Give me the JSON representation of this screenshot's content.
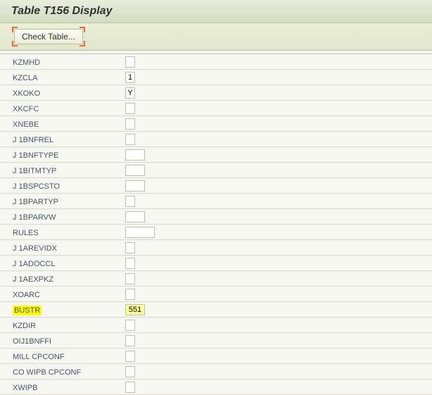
{
  "title": "Table T156 Display",
  "toolbar": {
    "check_label": "Check Table..."
  },
  "fields": [
    {
      "label": "KZMHD",
      "value": "",
      "w": 1,
      "hl": false
    },
    {
      "label": "KZCLA",
      "value": "1",
      "w": 1,
      "hl": false
    },
    {
      "label": "XKOKO",
      "value": "Y",
      "w": 1,
      "hl": false
    },
    {
      "label": "XKCFC",
      "value": "",
      "w": 1,
      "hl": false
    },
    {
      "label": "XNEBE",
      "value": "",
      "w": 1,
      "hl": false
    },
    {
      "label": "J 1BNFREL",
      "value": "",
      "w": 1,
      "hl": false
    },
    {
      "label": "J 1BNFTYPE",
      "value": "",
      "w": 2,
      "hl": false
    },
    {
      "label": "J 1BITMTYP",
      "value": "",
      "w": 2,
      "hl": false
    },
    {
      "label": "J 1BSPCSTO",
      "value": "",
      "w": 2,
      "hl": false
    },
    {
      "label": "J 1BPARTYP",
      "value": "",
      "w": 1,
      "hl": false
    },
    {
      "label": "J 1BPARVW",
      "value": "",
      "w": 2,
      "hl": false
    },
    {
      "label": "RULES",
      "value": "",
      "w": 3,
      "hl": false
    },
    {
      "label": "J 1AREVIDX",
      "value": "",
      "w": 1,
      "hl": false
    },
    {
      "label": "J 1ADOCCL",
      "value": "",
      "w": 1,
      "hl": false
    },
    {
      "label": "J 1AEXPKZ",
      "value": "",
      "w": 1,
      "hl": false
    },
    {
      "label": "XOARC",
      "value": "",
      "w": 1,
      "hl": false
    },
    {
      "label": "BUSTR",
      "value": "551",
      "w": 2,
      "hl": true
    },
    {
      "label": "KZDIR",
      "value": "",
      "w": 1,
      "hl": false
    },
    {
      "label": "OIJ1BNFFI",
      "value": "",
      "w": 1,
      "hl": false
    },
    {
      "label": "MILL CPCONF",
      "value": "",
      "w": 1,
      "hl": false
    },
    {
      "label": "CO WIPB CPCONF",
      "value": "",
      "w": 1,
      "hl": false
    },
    {
      "label": "XWIPB",
      "value": "",
      "w": 1,
      "hl": false
    }
  ]
}
